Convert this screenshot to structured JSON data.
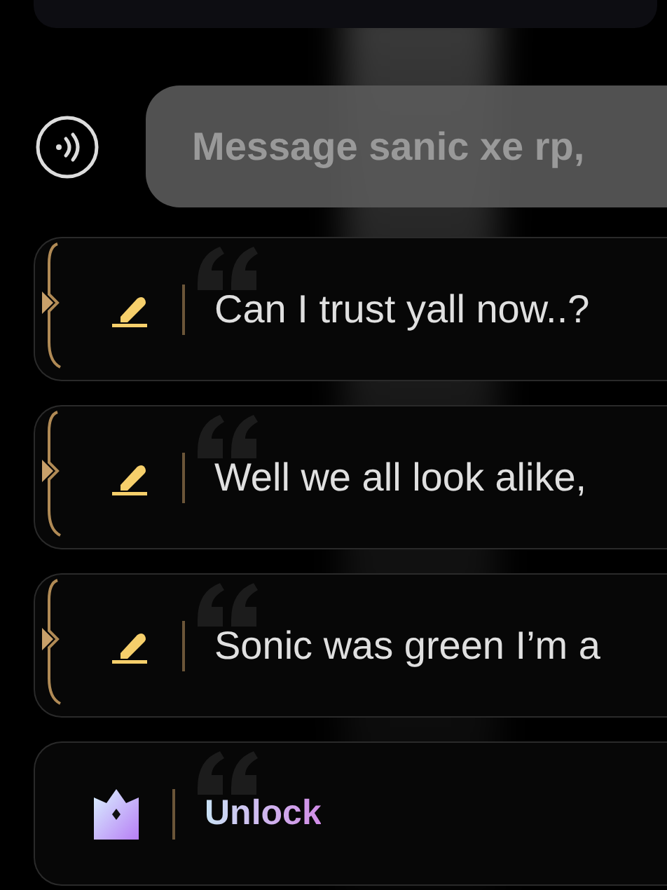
{
  "composer": {
    "placeholder": "Message sanic xe rp,"
  },
  "suggestions": [
    {
      "kind": "suggestion",
      "text": "Can I trust yall now..?"
    },
    {
      "kind": "suggestion",
      "text": "Well we all look alike,"
    },
    {
      "kind": "suggestion",
      "text": "Sonic was green I’m a"
    },
    {
      "kind": "unlock",
      "text": "Unlock"
    }
  ]
}
